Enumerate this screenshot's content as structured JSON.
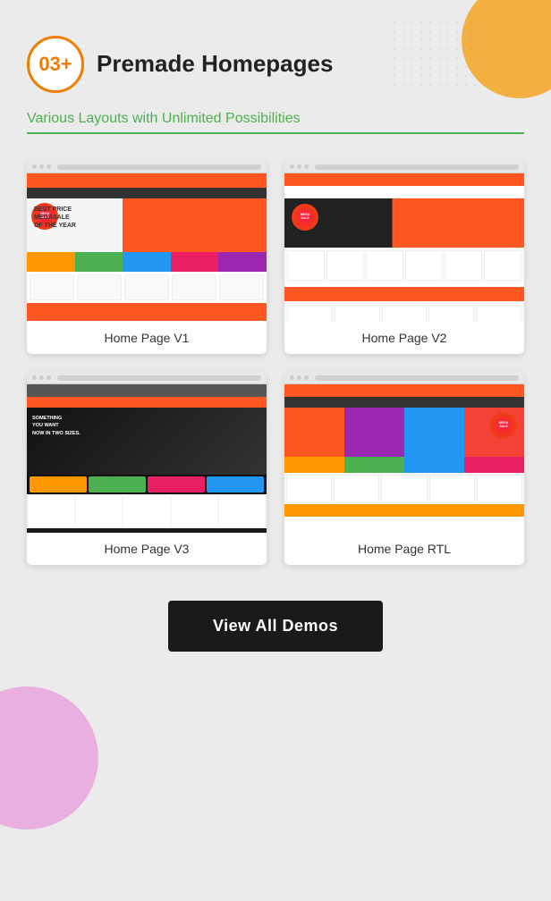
{
  "page": {
    "background": "#ebebeb"
  },
  "header": {
    "badge": "03+",
    "title": "Premade Homepages",
    "subtitle": "Various Layouts with Unlimited Possibilities"
  },
  "demos": [
    {
      "id": "v1",
      "label": "Home Page V1"
    },
    {
      "id": "v2",
      "label": "Home Page V2"
    },
    {
      "id": "v3",
      "label": "Home Page V3"
    },
    {
      "id": "rtl",
      "label": "Home Page RTL"
    }
  ],
  "cta": {
    "label": "View All Demos"
  },
  "icons": {
    "circle_badge": "03+"
  }
}
